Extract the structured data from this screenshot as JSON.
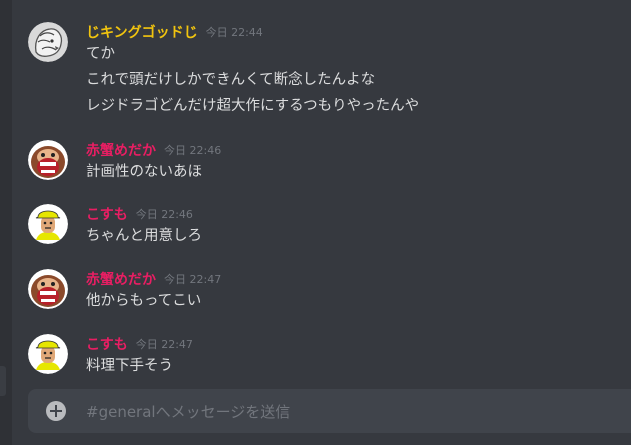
{
  "colors": {
    "background": "#36393f",
    "text": "#dcddde",
    "timestamp": "#72767d",
    "user_gold": "#f1c40f",
    "user_red": "#e91e63"
  },
  "messages": [
    {
      "username": "じキングゴッドじ",
      "timestamp": "今日 22:44",
      "avatar_icon": "lion-avatar-icon",
      "lines": [
        "てか",
        "これで頭だけしかできんくて断念したんよな",
        "レジドラゴどんだけ超大作にするつもりやったんや"
      ]
    },
    {
      "username": "赤蟹めだか",
      "timestamp": "今日 22:46",
      "avatar_icon": "ape-avatar-icon",
      "lines": [
        "計画性のないあほ"
      ]
    },
    {
      "username": "こすも",
      "timestamp": "今日 22:46",
      "avatar_icon": "hardhat-avatar-icon",
      "lines": [
        "ちゃんと用意しろ"
      ]
    },
    {
      "username": "赤蟹めだか",
      "timestamp": "今日 22:47",
      "avatar_icon": "ape-avatar-icon",
      "lines": [
        "他からもってこい"
      ]
    },
    {
      "username": "こすも",
      "timestamp": "今日 22:47",
      "avatar_icon": "hardhat-avatar-icon",
      "lines": [
        "料理下手そう"
      ]
    }
  ],
  "composer": {
    "placeholder": "#generalへメッセージを送信",
    "plus_icon": "plus-circle-icon"
  }
}
